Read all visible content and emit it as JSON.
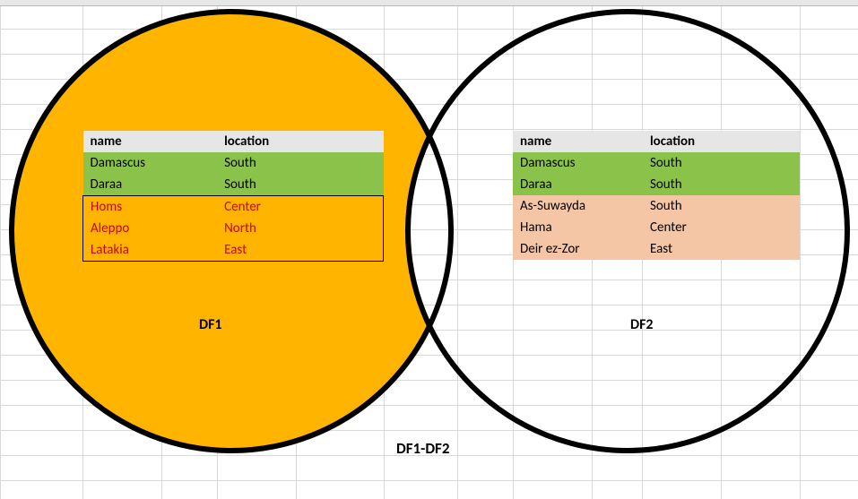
{
  "df1": {
    "label": "DF1",
    "columns": [
      "name",
      "location"
    ],
    "rows": [
      {
        "name": "Damascus",
        "location": "South",
        "class": "green"
      },
      {
        "name": "Daraa",
        "location": "South",
        "class": "green"
      },
      {
        "name": "Homs",
        "location": "Center",
        "class": "orange"
      },
      {
        "name": "Aleppo",
        "location": "North",
        "class": "orange"
      },
      {
        "name": "Latakia",
        "location": "East",
        "class": "orange"
      }
    ]
  },
  "df2": {
    "label": "DF2",
    "columns": [
      "name",
      "location"
    ],
    "rows": [
      {
        "name": "Damascus",
        "location": "South",
        "class": "green"
      },
      {
        "name": "Daraa",
        "location": "South",
        "class": "green"
      },
      {
        "name": "As-Suwayda",
        "location": "South",
        "class": "peach"
      },
      {
        "name": "Hama",
        "location": "Center",
        "class": "peach"
      },
      {
        "name": "Deir ez-Zor",
        "location": "East",
        "class": "peach"
      }
    ]
  },
  "diff_label": "DF1-DF2",
  "colors": {
    "circle_fill": "#ffb400",
    "circle_stroke": "#000000",
    "green": "#8ac24a",
    "orange_bg": "#ffb400",
    "orange_text": "#c20a0a",
    "peach": "#f5c6a5",
    "header_bg": "#e6e6e6"
  },
  "chart_data": {
    "type": "table",
    "title": "DF1-DF2",
    "sets": [
      "DF1",
      "DF2"
    ],
    "highlight": "DF1 minus DF2 (rows in DF1 not in DF2)",
    "intersection_rows": [
      {
        "name": "Damascus",
        "location": "South"
      },
      {
        "name": "Daraa",
        "location": "South"
      }
    ],
    "df1_only_rows": [
      {
        "name": "Homs",
        "location": "Center"
      },
      {
        "name": "Aleppo",
        "location": "North"
      },
      {
        "name": "Latakia",
        "location": "East"
      }
    ],
    "df2_only_rows": [
      {
        "name": "As-Suwayda",
        "location": "South"
      },
      {
        "name": "Hama",
        "location": "Center"
      },
      {
        "name": "Deir ez-Zor",
        "location": "East"
      }
    ]
  }
}
